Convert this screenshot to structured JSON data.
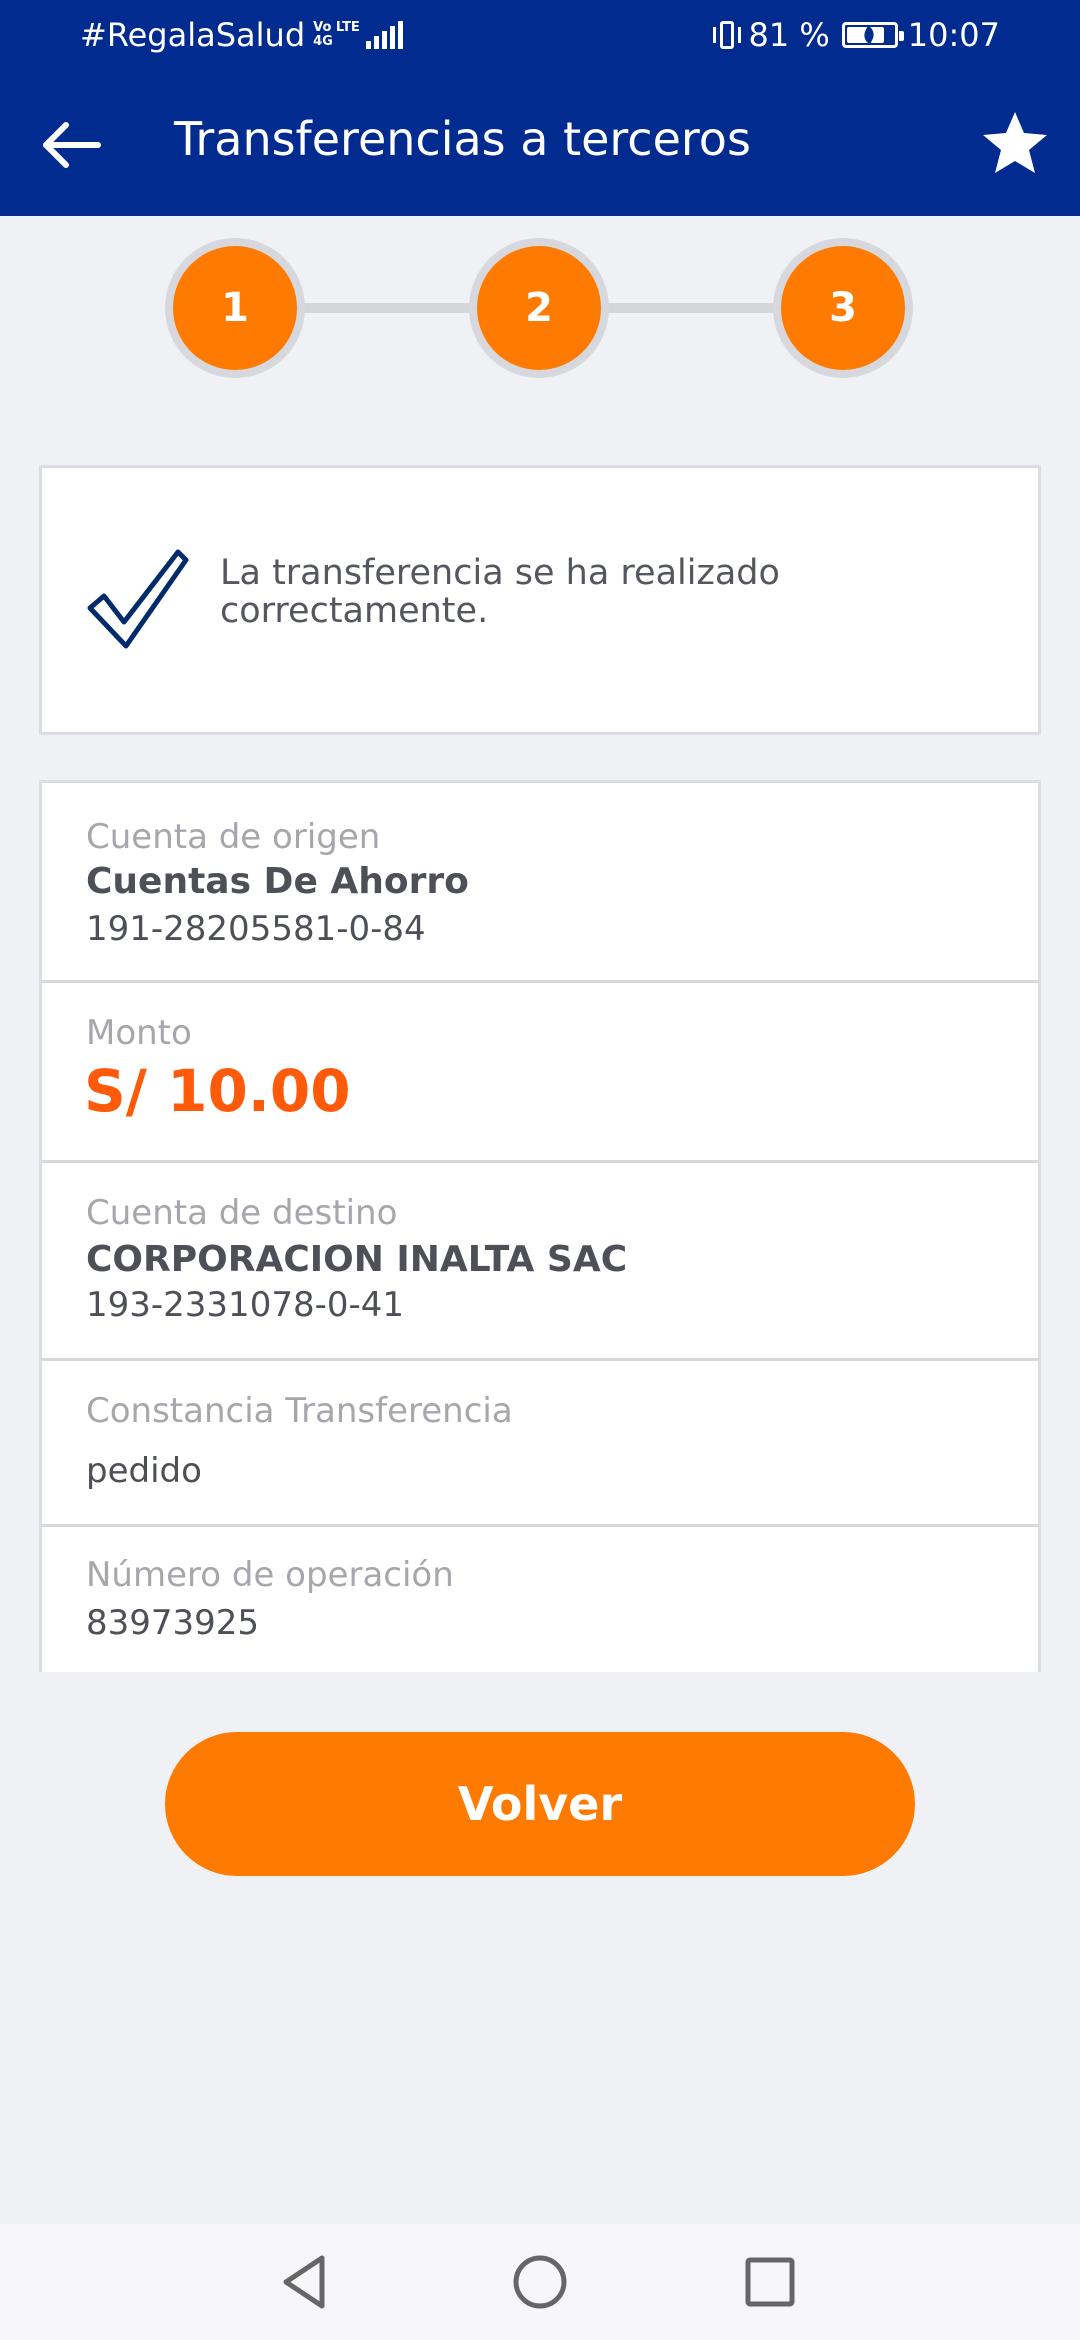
{
  "status_bar": {
    "carrier": "#RegalaSalud",
    "net_badge_top": "Vo LTE",
    "net_badge_bottom": "4G",
    "battery_percent": "81 %",
    "time": "10:07",
    "battery_level": 0.81
  },
  "toolbar": {
    "title": "Transferencias a terceros",
    "back_icon": "arrow-left-icon",
    "favorite_icon": "star-icon"
  },
  "stepper": {
    "steps": [
      "1",
      "2",
      "3"
    ],
    "current_step": 3
  },
  "success": {
    "icon": "checkmark-icon",
    "message": "La transferencia se ha realizado correctamente."
  },
  "details": {
    "origin": {
      "label": "Cuenta de origen",
      "name": "Cuentas De Ahorro",
      "number": "191-28205581-0-84"
    },
    "amount": {
      "label": "Monto",
      "value": "S/ 10.00"
    },
    "destination": {
      "label": "Cuenta de destino",
      "name": "CORPORACION INALTA SAC",
      "number": "193-2331078-0-41"
    },
    "voucher": {
      "label": "Constancia Transferencia",
      "value": "pedido"
    },
    "operation": {
      "label": "Número de operación",
      "value": "83973925"
    }
  },
  "actions": {
    "back_label": "Volver"
  },
  "colors": {
    "primary_blue": "#022b8f",
    "accent_orange": "#ff7a00",
    "amount_orange": "#ff5a0a"
  }
}
